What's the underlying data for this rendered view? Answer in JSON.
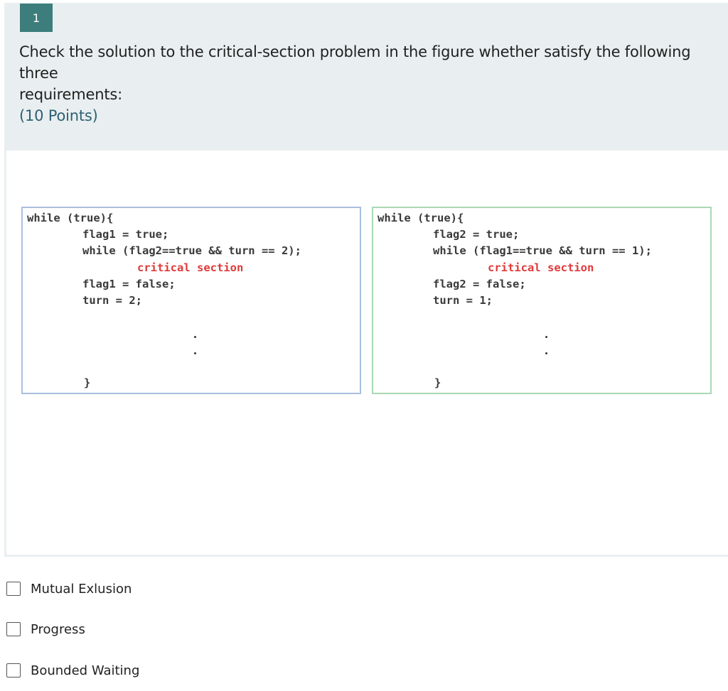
{
  "question": {
    "number": "1",
    "text_lines": [
      "Check the solution to the critical-section problem in the figure whether satisfy the following",
      "three",
      "requirements:"
    ],
    "points": "(10 Points)"
  },
  "figure": {
    "left_process": {
      "lines": [
        "while (true){",
        "flag1 = true;",
        "while (flag2==true && turn == 2);",
        "critical section",
        "flag1 = false;",
        "turn = 2;",
        "}"
      ]
    },
    "right_process": {
      "lines": [
        "while (true){",
        "flag2 = true;",
        "while (flag1==true && turn == 1);",
        "critical section",
        "flag2 = false;",
        "turn = 1;",
        "}"
      ]
    }
  },
  "options": [
    {
      "label": "Mutual Exlusion",
      "checked": false
    },
    {
      "label": "Progress",
      "checked": false
    },
    {
      "label": "Bounded Waiting",
      "checked": false
    }
  ],
  "colors": {
    "number_badge": "#3d7e7c",
    "header_bg": "#e9eff0",
    "points_text": "#2f5f73",
    "critical_section_text": "#e03a3a",
    "left_panel_border": "#a9bfdd",
    "right_panel_border": "#a9d8b3"
  }
}
